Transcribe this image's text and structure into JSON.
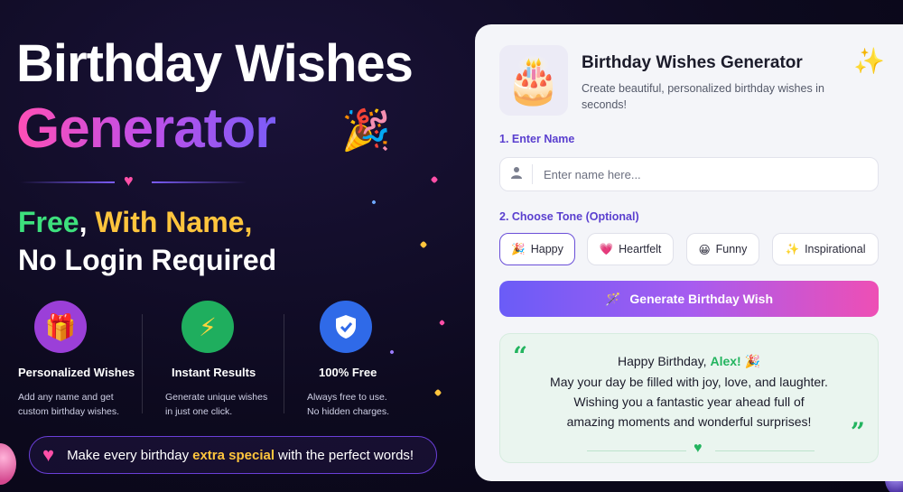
{
  "hero": {
    "title_line1": "Birthday Wishes",
    "title_line2": "Generator",
    "tagline_free": "Free",
    "tagline_sep": ", ",
    "tagline_with_name": "With Name,",
    "tagline_line2": "No Login Required"
  },
  "features": [
    {
      "icon": "gift-icon",
      "title": "Personalized Wishes",
      "line1": "Add any name and get",
      "line2": "custom birthday wishes.",
      "color": "#9b3fd8"
    },
    {
      "icon": "lightning-icon",
      "title": "Instant Results",
      "line1": "Generate unique wishes",
      "line2": "in just one click.",
      "color": "#1fae5e"
    },
    {
      "icon": "shield-check-icon",
      "title": "100% Free",
      "line1": "Always free to use.",
      "line2": "No hidden charges.",
      "color": "#2f6ae8"
    }
  ],
  "banner": {
    "before": "Make every birthday",
    "highlight": "extra special",
    "after": "with the perfect words!"
  },
  "card": {
    "title": "Birthday Wishes Generator",
    "subtitle": "Create beautiful, personalized birthday wishes in seconds!",
    "step1_label": "1. Enter Name",
    "name_placeholder": "Enter name here...",
    "step2_label": "2. Choose Tone (Optional)",
    "tones": [
      {
        "emoji": "🎉",
        "label": "Happy",
        "active": true
      },
      {
        "emoji": "💗",
        "label": "Heartfelt",
        "active": false
      },
      {
        "emoji": "😀",
        "label": "Funny",
        "active": false
      },
      {
        "emoji": "✨",
        "label": "Inspirational",
        "active": false
      }
    ],
    "generate_button": "Generate Birthday Wish"
  },
  "result": {
    "greeting": "Happy Birthday,",
    "name": "Alex!",
    "line2": "May your day be filled with joy, love, and laughter.",
    "line3": "Wishing you a fantastic year ahead full of",
    "line4": "amazing moments and wonderful surprises!"
  },
  "colors": {
    "accent_purple": "#6a4fd8",
    "pink": "#ff4fa8",
    "green": "#23b45f",
    "yellow": "#ffc53d"
  }
}
